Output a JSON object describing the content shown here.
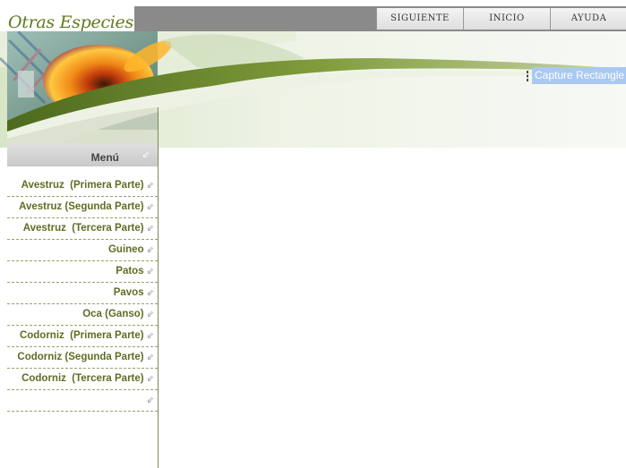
{
  "header": {
    "site_title": "Otras Especies",
    "nav": [
      {
        "label": "SIGUIENTE"
      },
      {
        "label": "INICIO"
      },
      {
        "label": "AYUDA"
      }
    ]
  },
  "capture_tool": {
    "label": "Capture Rectangle"
  },
  "sidebar": {
    "menu_title": "Menú",
    "arrow_glyph": "⇙",
    "items": [
      {
        "label": "Avestruz  (Primera Parte)"
      },
      {
        "label": "Avestruz (Segunda Parte)"
      },
      {
        "label": "Avestruz  (Tercera Parte)"
      },
      {
        "label": "Guineo"
      },
      {
        "label": "Patos"
      },
      {
        "label": "Pavos"
      },
      {
        "label": "Oca (Ganso)"
      },
      {
        "label": "Codorniz  (Primera Parte)"
      },
      {
        "label": "Codorniz (Segunda Parte)"
      },
      {
        "label": "Codorniz  (Tercera Parte)"
      },
      {
        "label": ""
      }
    ]
  },
  "colors": {
    "title_green": "#5e7a1d",
    "menu_text": "#5e6e22",
    "nav_strip": "#8a8a8a",
    "capture_highlight": "#a9c9f3"
  }
}
